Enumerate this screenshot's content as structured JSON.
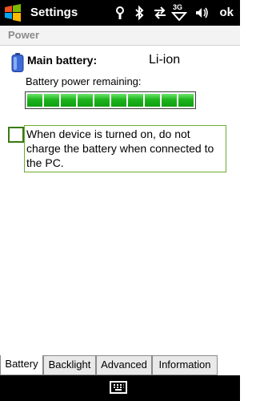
{
  "topbar": {
    "title": "Settings",
    "ok_label": "ok",
    "network_label": "3G"
  },
  "section": {
    "title": "Power"
  },
  "battery": {
    "label": "Main battery:",
    "type": "Li-ion",
    "remaining_label": "Battery power remaining:",
    "remaining_fraction": 1.0
  },
  "charge_option": {
    "checked": false,
    "text": "When device is turned on, do not charge the battery when connected to the PC."
  },
  "tabs": [
    {
      "label": "Battery",
      "active": true
    },
    {
      "label": "Backlight",
      "active": false
    },
    {
      "label": "Advanced",
      "active": false
    },
    {
      "label": "Information",
      "active": false
    }
  ],
  "colors": {
    "bar_fill": "#1eb41e",
    "accent": "#6aac2e"
  }
}
